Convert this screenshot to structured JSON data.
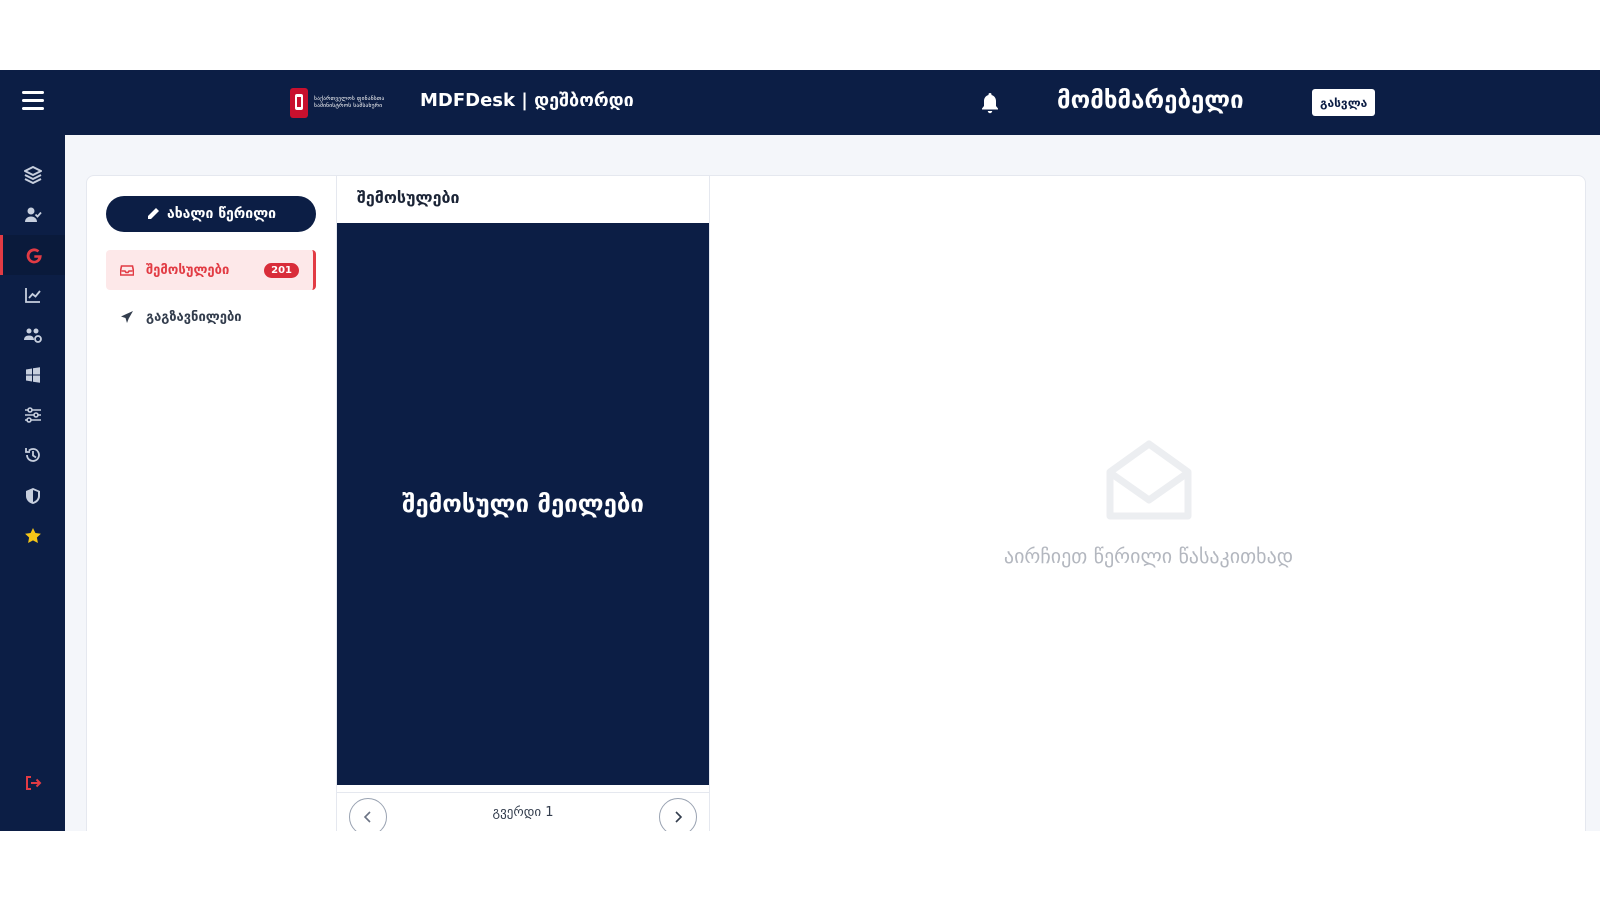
{
  "header": {
    "logo_text": "საქართველოს ფინანსთა სამინისტროს სამსახური",
    "app_title": "MDFDesk | დეშბორდი",
    "username": "მომხმარებელი",
    "logout_label": "გასვლა"
  },
  "sidebar": {
    "compose_label": "ახალი წერილი",
    "folders": [
      {
        "label": "შემოსულები",
        "count": "201"
      },
      {
        "label": "გაგზავნილები"
      }
    ]
  },
  "list": {
    "header": "შემოსულები",
    "overlay_text": "შემოსული მეილები",
    "page_label": "გვერდი 1"
  },
  "empty_state": {
    "text": "აირჩიეთ წერილი წასაკითხად"
  },
  "colors": {
    "navy": "#0c1e45",
    "accent_red": "#e23b44",
    "badge_red": "#d92d3a"
  }
}
